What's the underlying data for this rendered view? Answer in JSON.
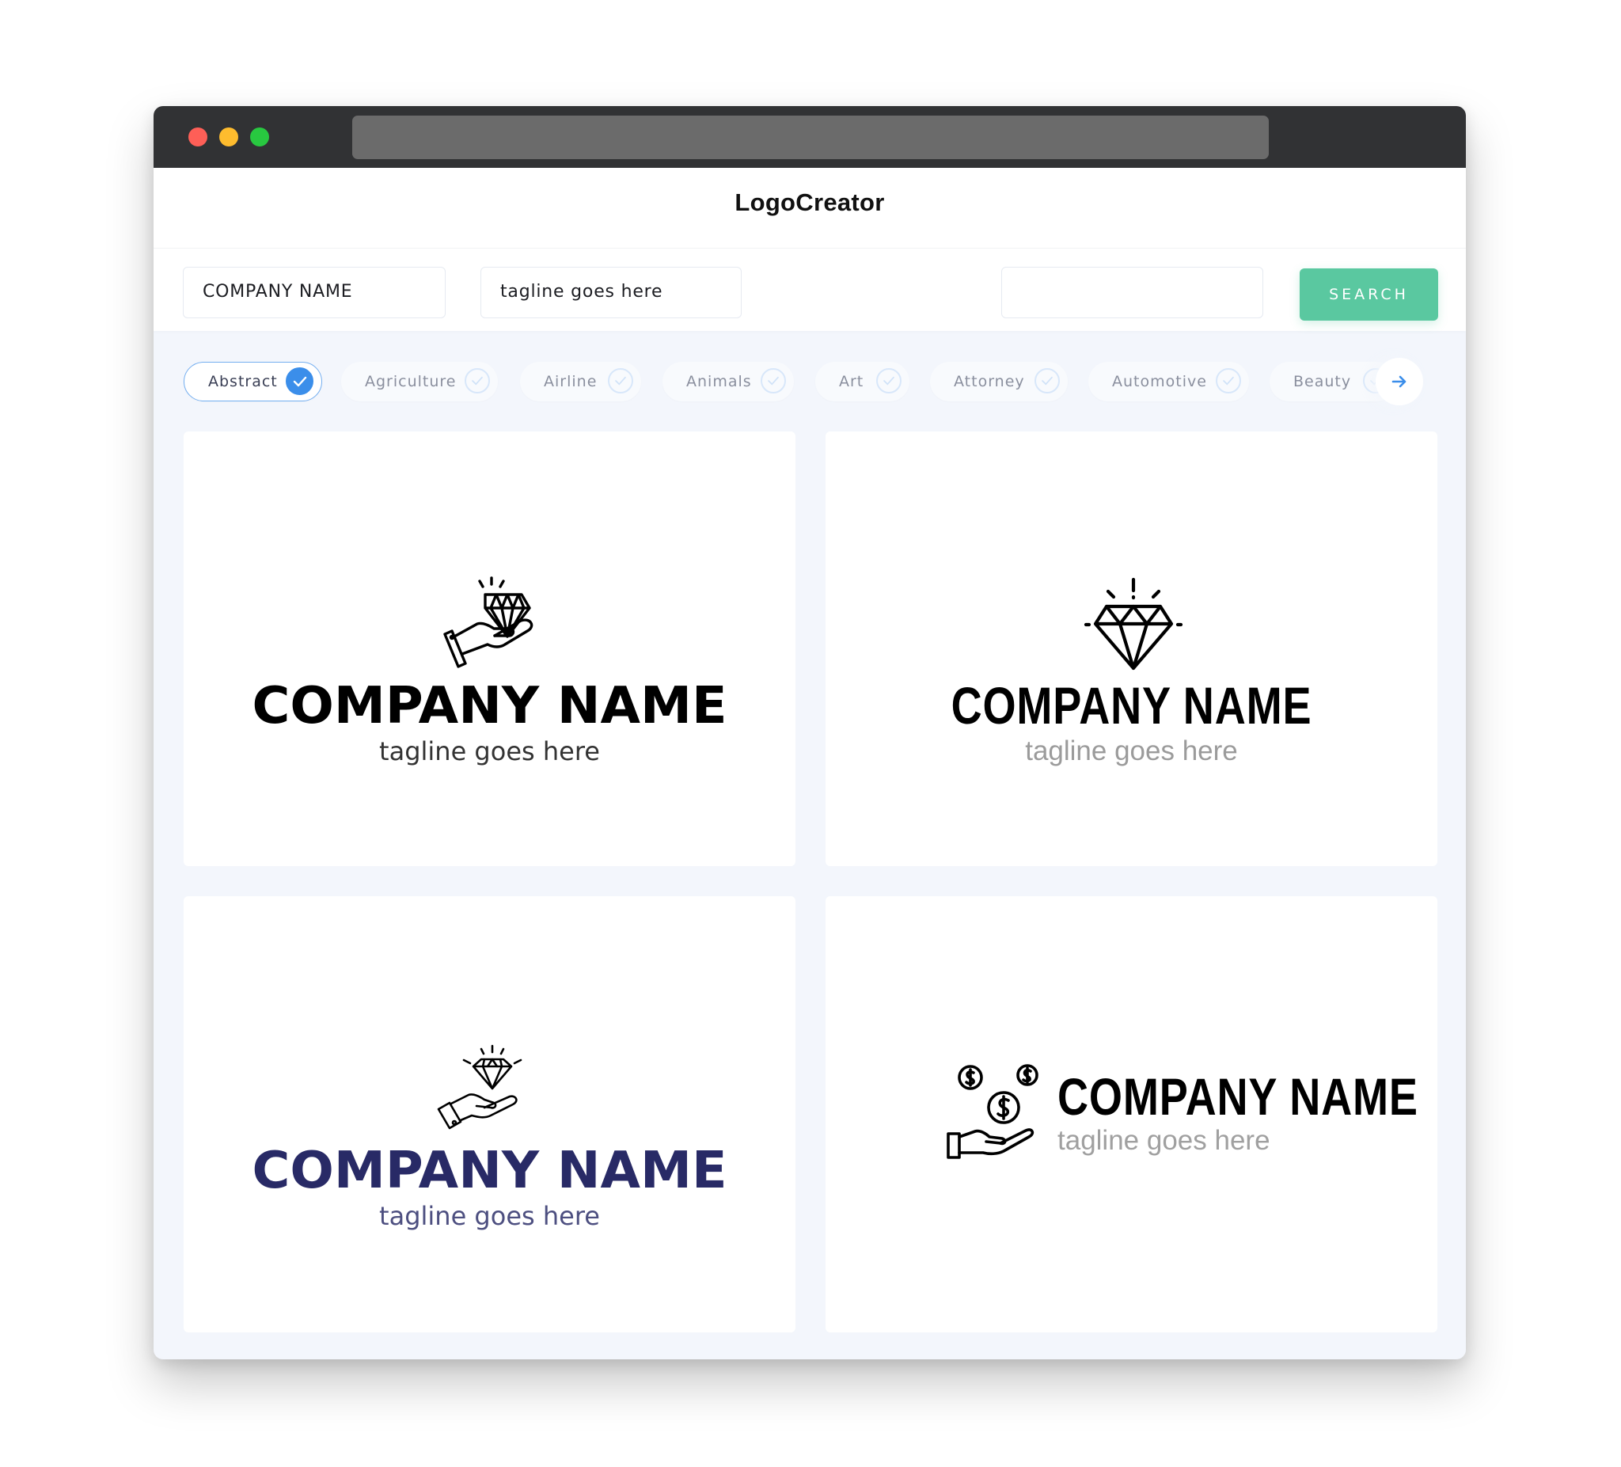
{
  "window": {
    "controls": [
      "close",
      "minimize",
      "maximize"
    ],
    "url": ""
  },
  "header": {
    "title": "LogoCreator"
  },
  "search": {
    "company_name_value": "COMPANY NAME",
    "tagline_value": "tagline goes here",
    "keyword_value": "",
    "button_label": "SEARCH"
  },
  "categories": {
    "items": [
      {
        "label": "Abstract",
        "selected": true
      },
      {
        "label": "Agriculture",
        "selected": false
      },
      {
        "label": "Airline",
        "selected": false
      },
      {
        "label": "Animals",
        "selected": false
      },
      {
        "label": "Art",
        "selected": false
      },
      {
        "label": "Attorney",
        "selected": false
      },
      {
        "label": "Automotive",
        "selected": false
      },
      {
        "label": "Beauty",
        "selected": false
      }
    ],
    "next_icon": "arrow-right-icon"
  },
  "colors": {
    "accent_green": "#5ac8a0",
    "accent_blue": "#3b8eea",
    "navy": "#282a66"
  },
  "logos": [
    {
      "icon": "hand-diamond-icon",
      "name": "COMPANY NAME",
      "tagline": "tagline goes here",
      "name_color": "#000000",
      "tagline_color": "#333333"
    },
    {
      "icon": "diamond-icon",
      "name": "COMPANY NAME",
      "tagline": "tagline goes here",
      "name_color": "#000000",
      "tagline_color": "#9b9b9b"
    },
    {
      "icon": "hand-diamond-icon",
      "name": "COMPANY NAME",
      "tagline": "tagline goes here",
      "name_color": "#282a66",
      "tagline_color": "#4d4f80"
    },
    {
      "icon": "hand-coins-icon",
      "name": "COMPANY NAME",
      "tagline": "tagline goes here",
      "name_color": "#000000",
      "tagline_color": "#a0a0a0"
    }
  ]
}
